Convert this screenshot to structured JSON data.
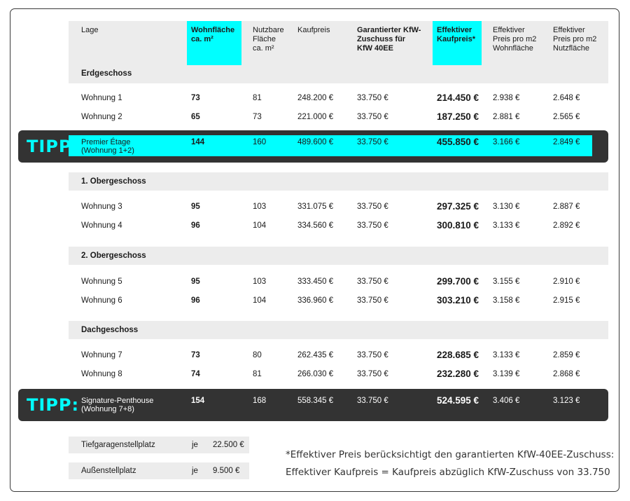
{
  "headers": {
    "lage": "Lage",
    "wohnflaeche": [
      "Wohnfläche",
      "ca. m²"
    ],
    "nutzbare": [
      "Nutzbare",
      "Fläche",
      "ca. m²"
    ],
    "kaufpreis": "Kaufpreis",
    "kfw": [
      "Garantierter KfW-",
      "Zuschuss für",
      "KfW 40EE"
    ],
    "effektiv": [
      "Effektiver",
      "Kaufpreis*"
    ],
    "preis_wohn": [
      "Effektiver",
      "Preis pro m2",
      "Wohnfläche"
    ],
    "preis_nutz": [
      "Effektiver",
      "Preis pro m2",
      "Nutzfläche"
    ]
  },
  "sections": {
    "eg": "Erdgeschoss",
    "og1": "1. Obergeschoss",
    "og2": "2. Obergeschoss",
    "dg": "Dachgeschoss"
  },
  "rows": {
    "w1": {
      "lage": "Wohnung 1",
      "wf": "73",
      "nf": "81",
      "kp": "248.200 €",
      "kfw": "33.750 €",
      "eff": "214.450 €",
      "pw": "2.938 €",
      "pn": "2.648 €"
    },
    "w2": {
      "lage": "Wohnung 2",
      "wf": "65",
      "nf": "73",
      "kp": "221.000 €",
      "kfw": "33.750 €",
      "eff": "187.250 €",
      "pw": "2.881 €",
      "pn": "2.565 €"
    },
    "tip1": {
      "lage1": "Premier Étage",
      "lage2": "(Wohnung 1+2)",
      "wf": "144",
      "nf": "160",
      "kp": "489.600 €",
      "kfw": "33.750 €",
      "eff": "455.850 €",
      "pw": "3.166 €",
      "pn": "2.849 €"
    },
    "w3": {
      "lage": "Wohnung 3",
      "wf": "95",
      "nf": "103",
      "kp": "331.075 €",
      "kfw": "33.750 €",
      "eff": "297.325 €",
      "pw": "3.130 €",
      "pn": "2.887 €"
    },
    "w4": {
      "lage": "Wohnung 4",
      "wf": "96",
      "nf": "104",
      "kp": "334.560 €",
      "kfw": "33.750 €",
      "eff": "300.810 €",
      "pw": "3.133 €",
      "pn": "2.892 €"
    },
    "w5": {
      "lage": "Wohnung 5",
      "wf": "95",
      "nf": "103",
      "kp": "333.450 €",
      "kfw": "33.750 €",
      "eff": "299.700 €",
      "pw": "3.155 €",
      "pn": "2.910 €"
    },
    "w6": {
      "lage": "Wohnung 6",
      "wf": "96",
      "nf": "104",
      "kp": "336.960 €",
      "kfw": "33.750 €",
      "eff": "303.210 €",
      "pw": "3.158 €",
      "pn": "2.915 €"
    },
    "w7": {
      "lage": "Wohnung 7",
      "wf": "73",
      "nf": "80",
      "kp": "262.435 €",
      "kfw": "33.750 €",
      "eff": "228.685 €",
      "pw": "3.133 €",
      "pn": "2.859 €"
    },
    "w8": {
      "lage": "Wohnung 8",
      "wf": "74",
      "nf": "81",
      "kp": "266.030 €",
      "kfw": "33.750 €",
      "eff": "232.280 €",
      "pw": "3.139 €",
      "pn": "2.868 €"
    },
    "tip2": {
      "lage1": "Signature-Penthouse",
      "lage2": "(Wohnung 7+8)",
      "wf": "154",
      "nf": "168",
      "kp": "558.345 €",
      "kfw": "33.750 €",
      "eff": "524.595 €",
      "pw": "3.406 €",
      "pn": "3.123 €"
    }
  },
  "tipp_label": "TIPP:",
  "parking": {
    "tg_label": "Tiefgaragenstellplatz",
    "tg_je": "je",
    "tg_price": "22.500 €",
    "aus_label": "Außenstellplatz",
    "aus_je": "je",
    "aus_price": "9.500 €"
  },
  "note": {
    "line1": "*Effektiver Preis berücksichtigt den garantierten KfW-40EE-Zuschuss:",
    "line2": "Effektiver Kaufpreis = Kaufpreis abzüglich KfW-Zuschuss von 33.750"
  },
  "colors": {
    "accent": "#00ffff",
    "dark": "#333333",
    "header_bg": "#ececec"
  }
}
